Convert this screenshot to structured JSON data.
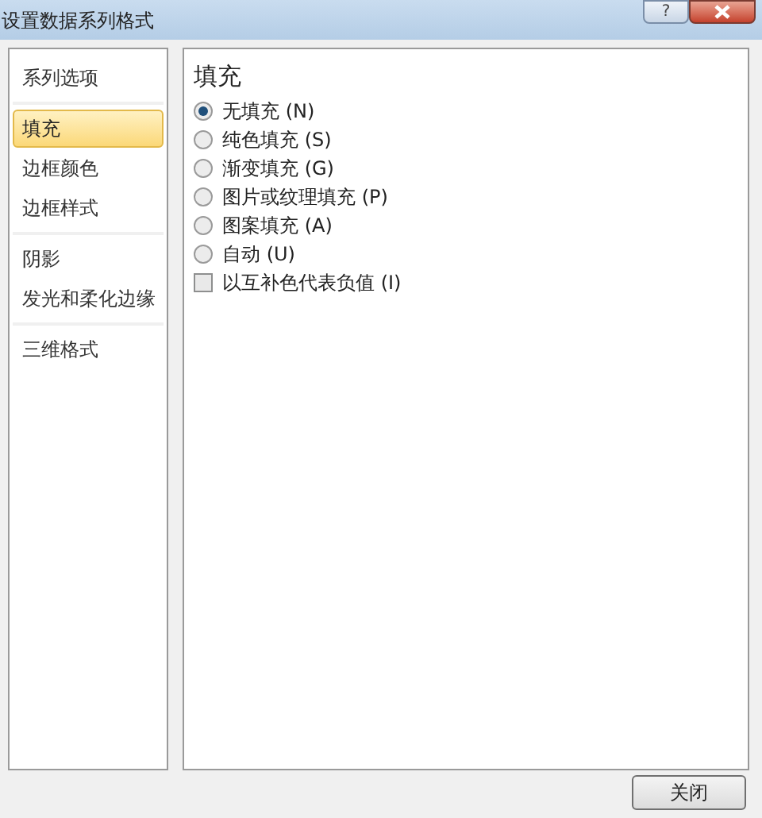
{
  "window": {
    "title": "设置数据系列格式",
    "help_button": "?"
  },
  "sidebar": {
    "groups": [
      {
        "items": [
          {
            "label": "系列选项",
            "selected": false
          }
        ]
      },
      {
        "items": [
          {
            "label": "填充",
            "selected": true
          },
          {
            "label": "边框颜色",
            "selected": false
          },
          {
            "label": "边框样式",
            "selected": false
          }
        ]
      },
      {
        "items": [
          {
            "label": "阴影",
            "selected": false
          },
          {
            "label": "发光和柔化边缘",
            "selected": false
          }
        ]
      },
      {
        "items": [
          {
            "label": "三维格式",
            "selected": false
          }
        ]
      }
    ]
  },
  "panel": {
    "heading": "填充",
    "options": [
      {
        "kind": "radio",
        "label": "无填充 (N)",
        "selected": true
      },
      {
        "kind": "radio",
        "label": "纯色填充 (S)",
        "selected": false
      },
      {
        "kind": "radio",
        "label": "渐变填充 (G)",
        "selected": false
      },
      {
        "kind": "radio",
        "label": "图片或纹理填充 (P)",
        "selected": false
      },
      {
        "kind": "radio",
        "label": "图案填充 (A)",
        "selected": false
      },
      {
        "kind": "radio",
        "label": "自动 (U)",
        "selected": false
      },
      {
        "kind": "checkbox",
        "label": "以互补色代表负值 (I)",
        "checked": false
      }
    ]
  },
  "buttons": [
    "关闭"
  ]
}
